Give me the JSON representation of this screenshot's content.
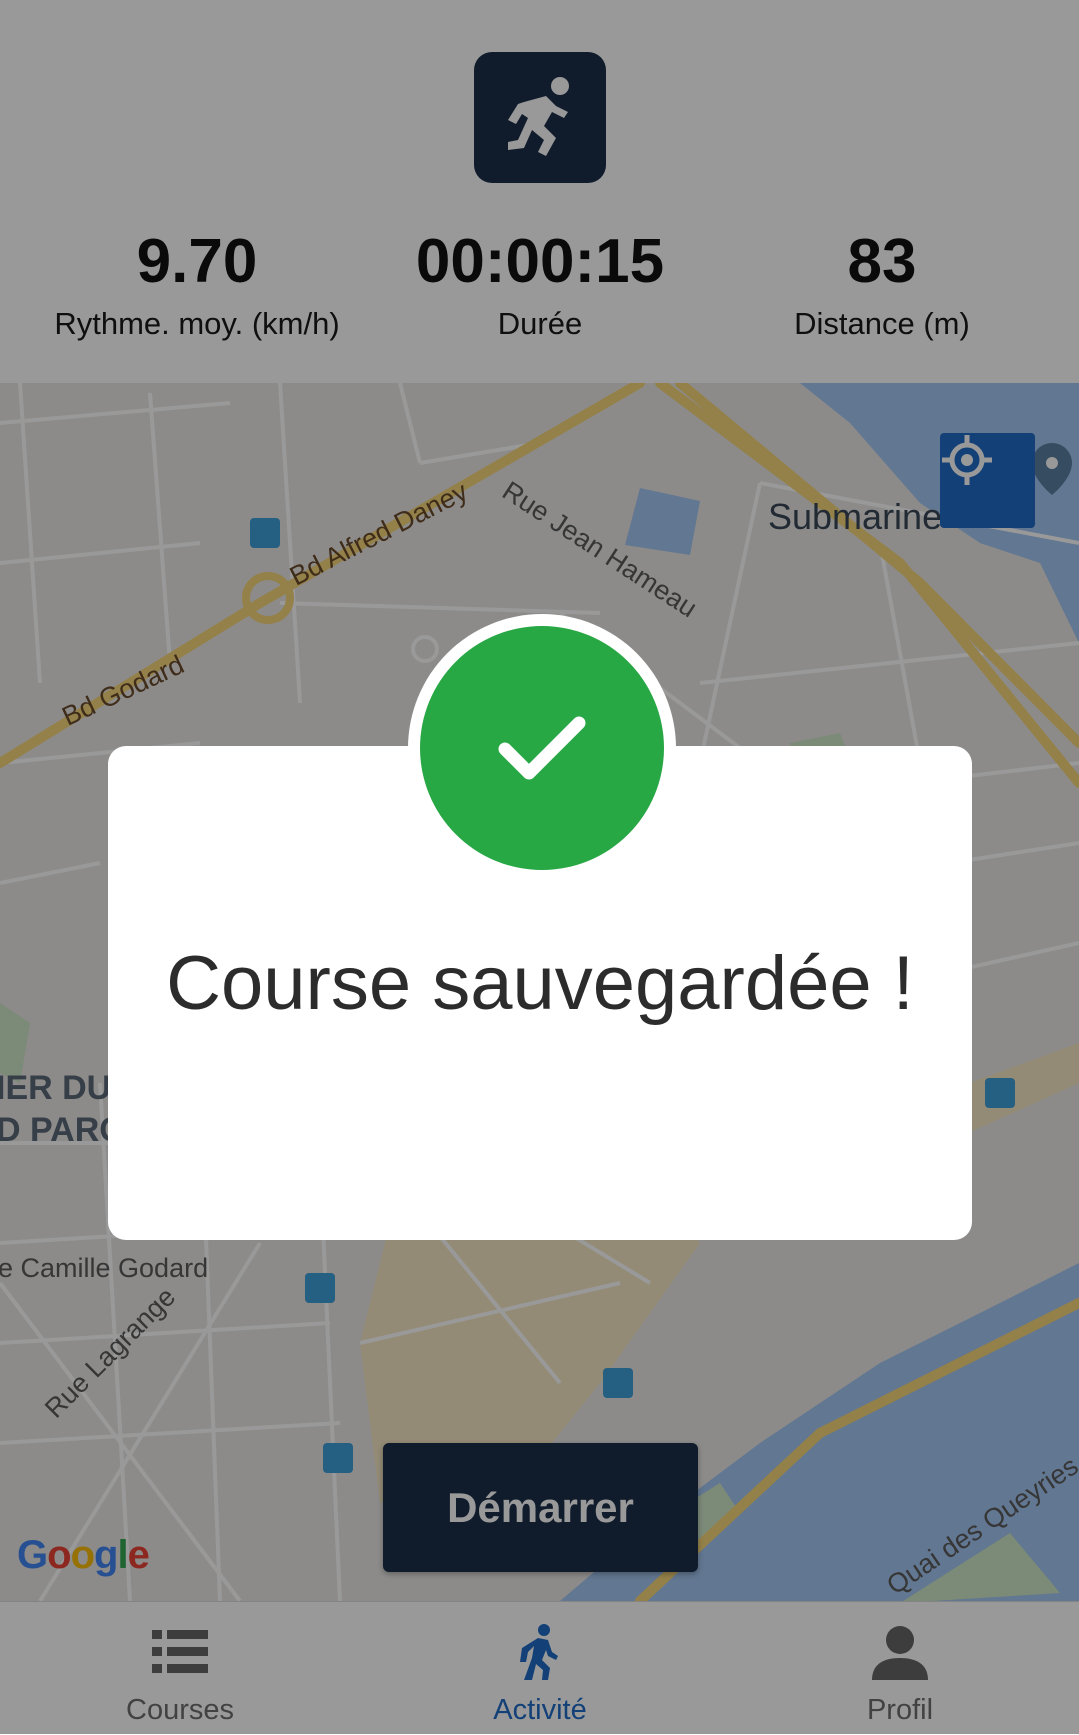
{
  "header": {
    "logo_icon": "running-man-icon",
    "stats": [
      {
        "value": "9.70",
        "label": "Rythme. moy. (km/h)"
      },
      {
        "value": "00:00:15",
        "label": "Durée"
      },
      {
        "value": "83",
        "label": "Distance (m)"
      }
    ]
  },
  "map": {
    "labels": {
      "bd_alfred_daney": "Bd Alfred Daney",
      "rue_jean_hameau": "Rue Jean Hameau",
      "submarine": "Submarine",
      "bd_godard": "Bd Godard",
      "quartier": "IER DU",
      "parc": "D PARC",
      "camille_godard": "e Camille Godard",
      "rue_lagrange": "Rue Lagrange",
      "quai_queyries": "Quai des Queyries"
    },
    "attribution": "Google",
    "locate_icon": "crosshair-locate-icon",
    "start_button": "Démarrer"
  },
  "nav": {
    "items": [
      {
        "label": "Courses",
        "icon": "list-icon"
      },
      {
        "label": "Activité",
        "icon": "walking-icon"
      },
      {
        "label": "Profil",
        "icon": "person-icon"
      }
    ],
    "active": "Activité"
  },
  "modal": {
    "icon": "checkmark-icon",
    "title": "Course sauvegardée !"
  },
  "colors": {
    "primary_dark": "#1c2f4a",
    "accent_blue": "#1f6cc7",
    "success_green": "#28a745"
  }
}
